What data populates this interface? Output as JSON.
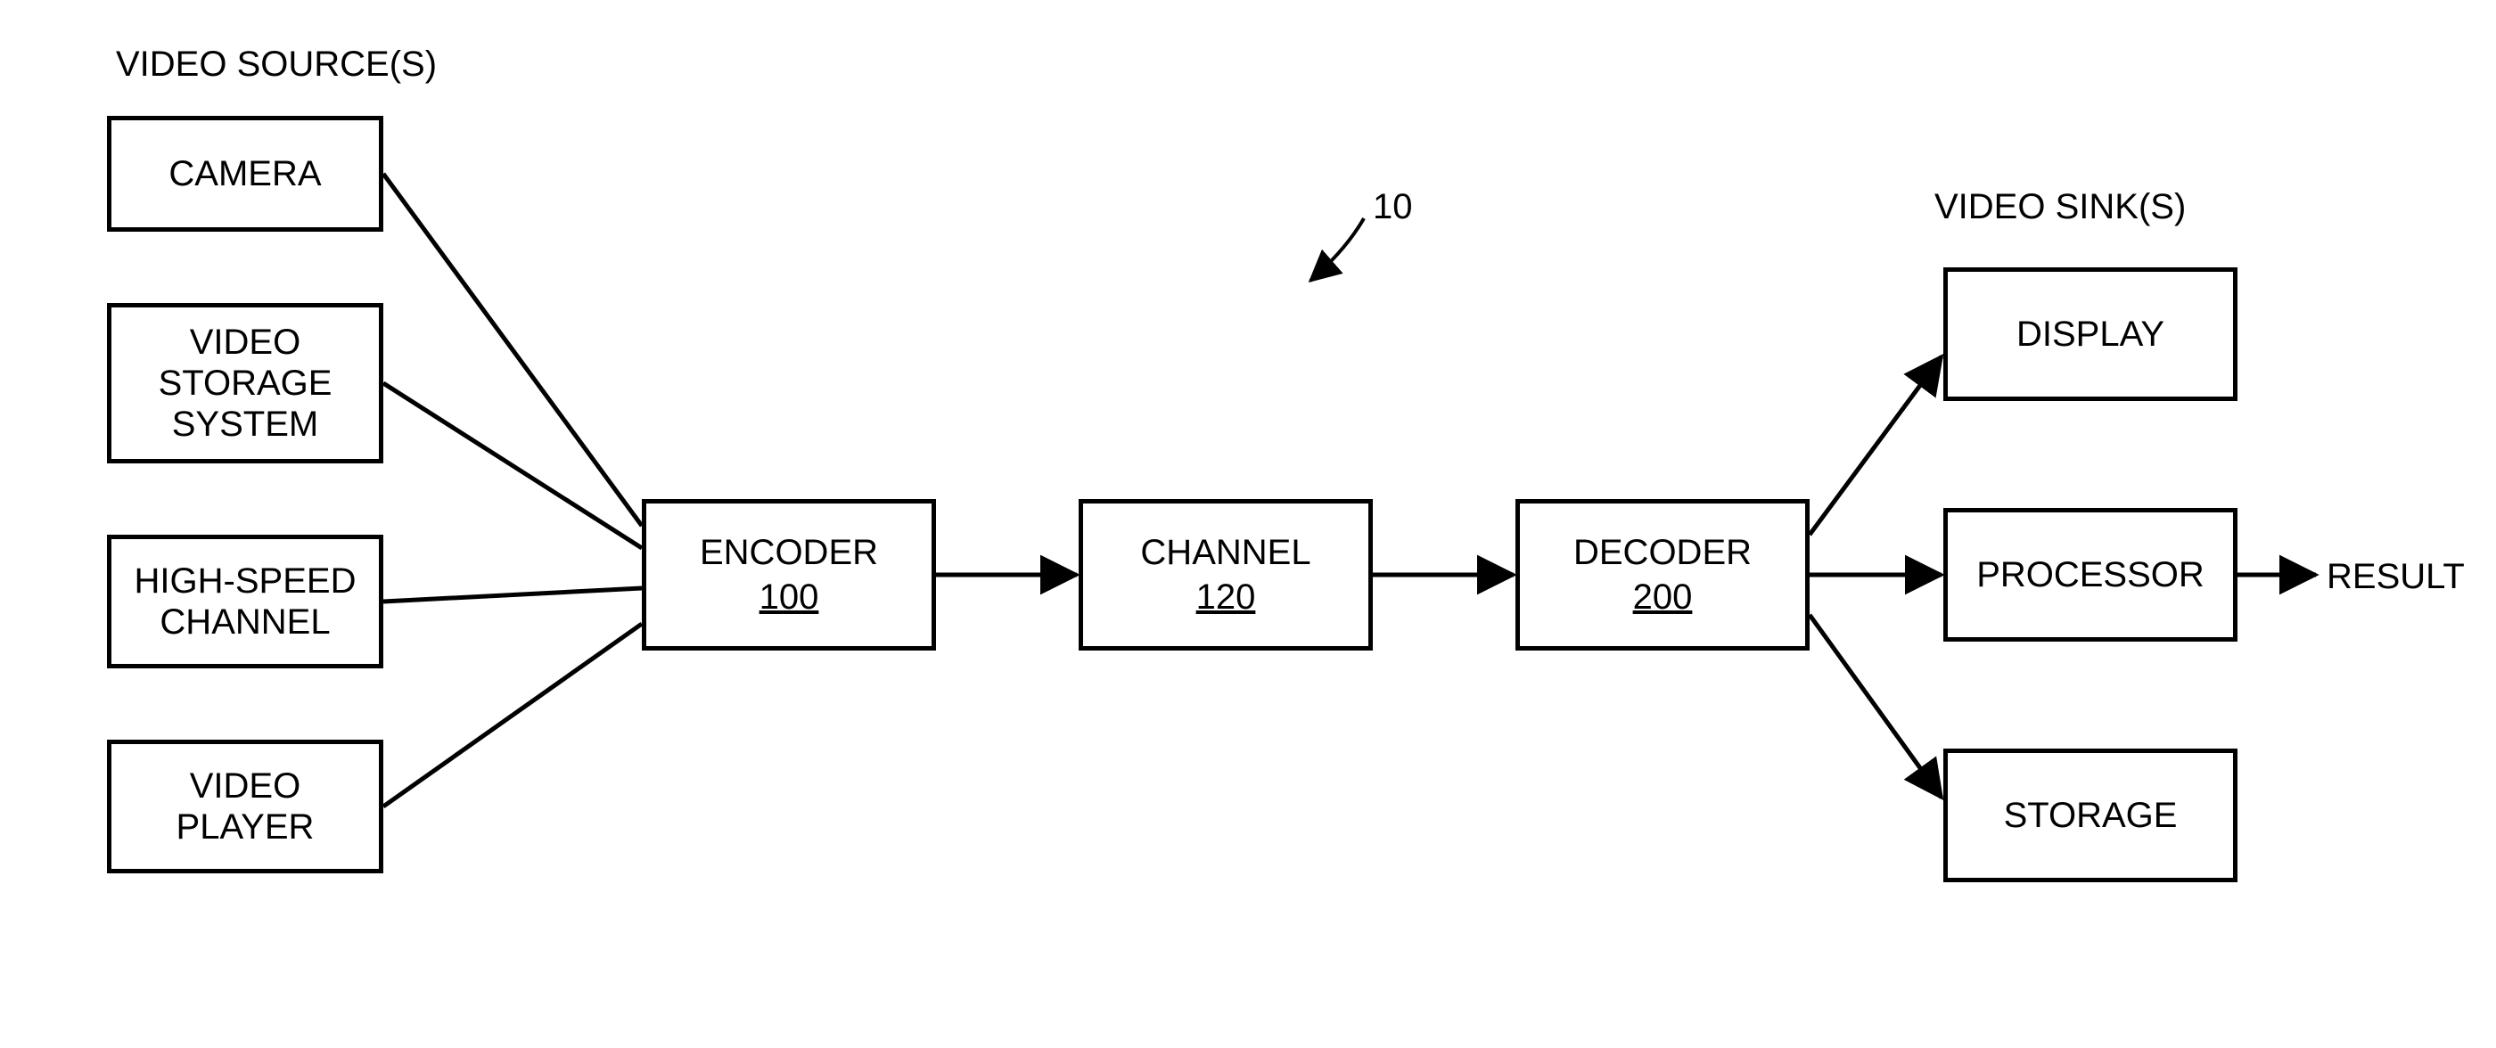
{
  "labels": {
    "sources_header": "VIDEO SOURCE(S)",
    "sinks_header": "VIDEO SINK(S)",
    "system_ref_num": "10",
    "result": "RESULT"
  },
  "sources": {
    "camera": "CAMERA",
    "storage_system_l1": "VIDEO",
    "storage_system_l2": "STORAGE",
    "storage_system_l3": "SYSTEM",
    "hs_channel_l1": "HIGH-SPEED",
    "hs_channel_l2": "CHANNEL",
    "player_l1": "VIDEO",
    "player_l2": "PLAYER"
  },
  "pipeline": {
    "encoder_label": "ENCODER",
    "encoder_ref": "100",
    "channel_label": "CHANNEL",
    "channel_ref": "120",
    "decoder_label": "DECODER",
    "decoder_ref": "200"
  },
  "sinks": {
    "display": "DISPLAY",
    "processor": "PROCESSOR",
    "storage": "STORAGE"
  }
}
